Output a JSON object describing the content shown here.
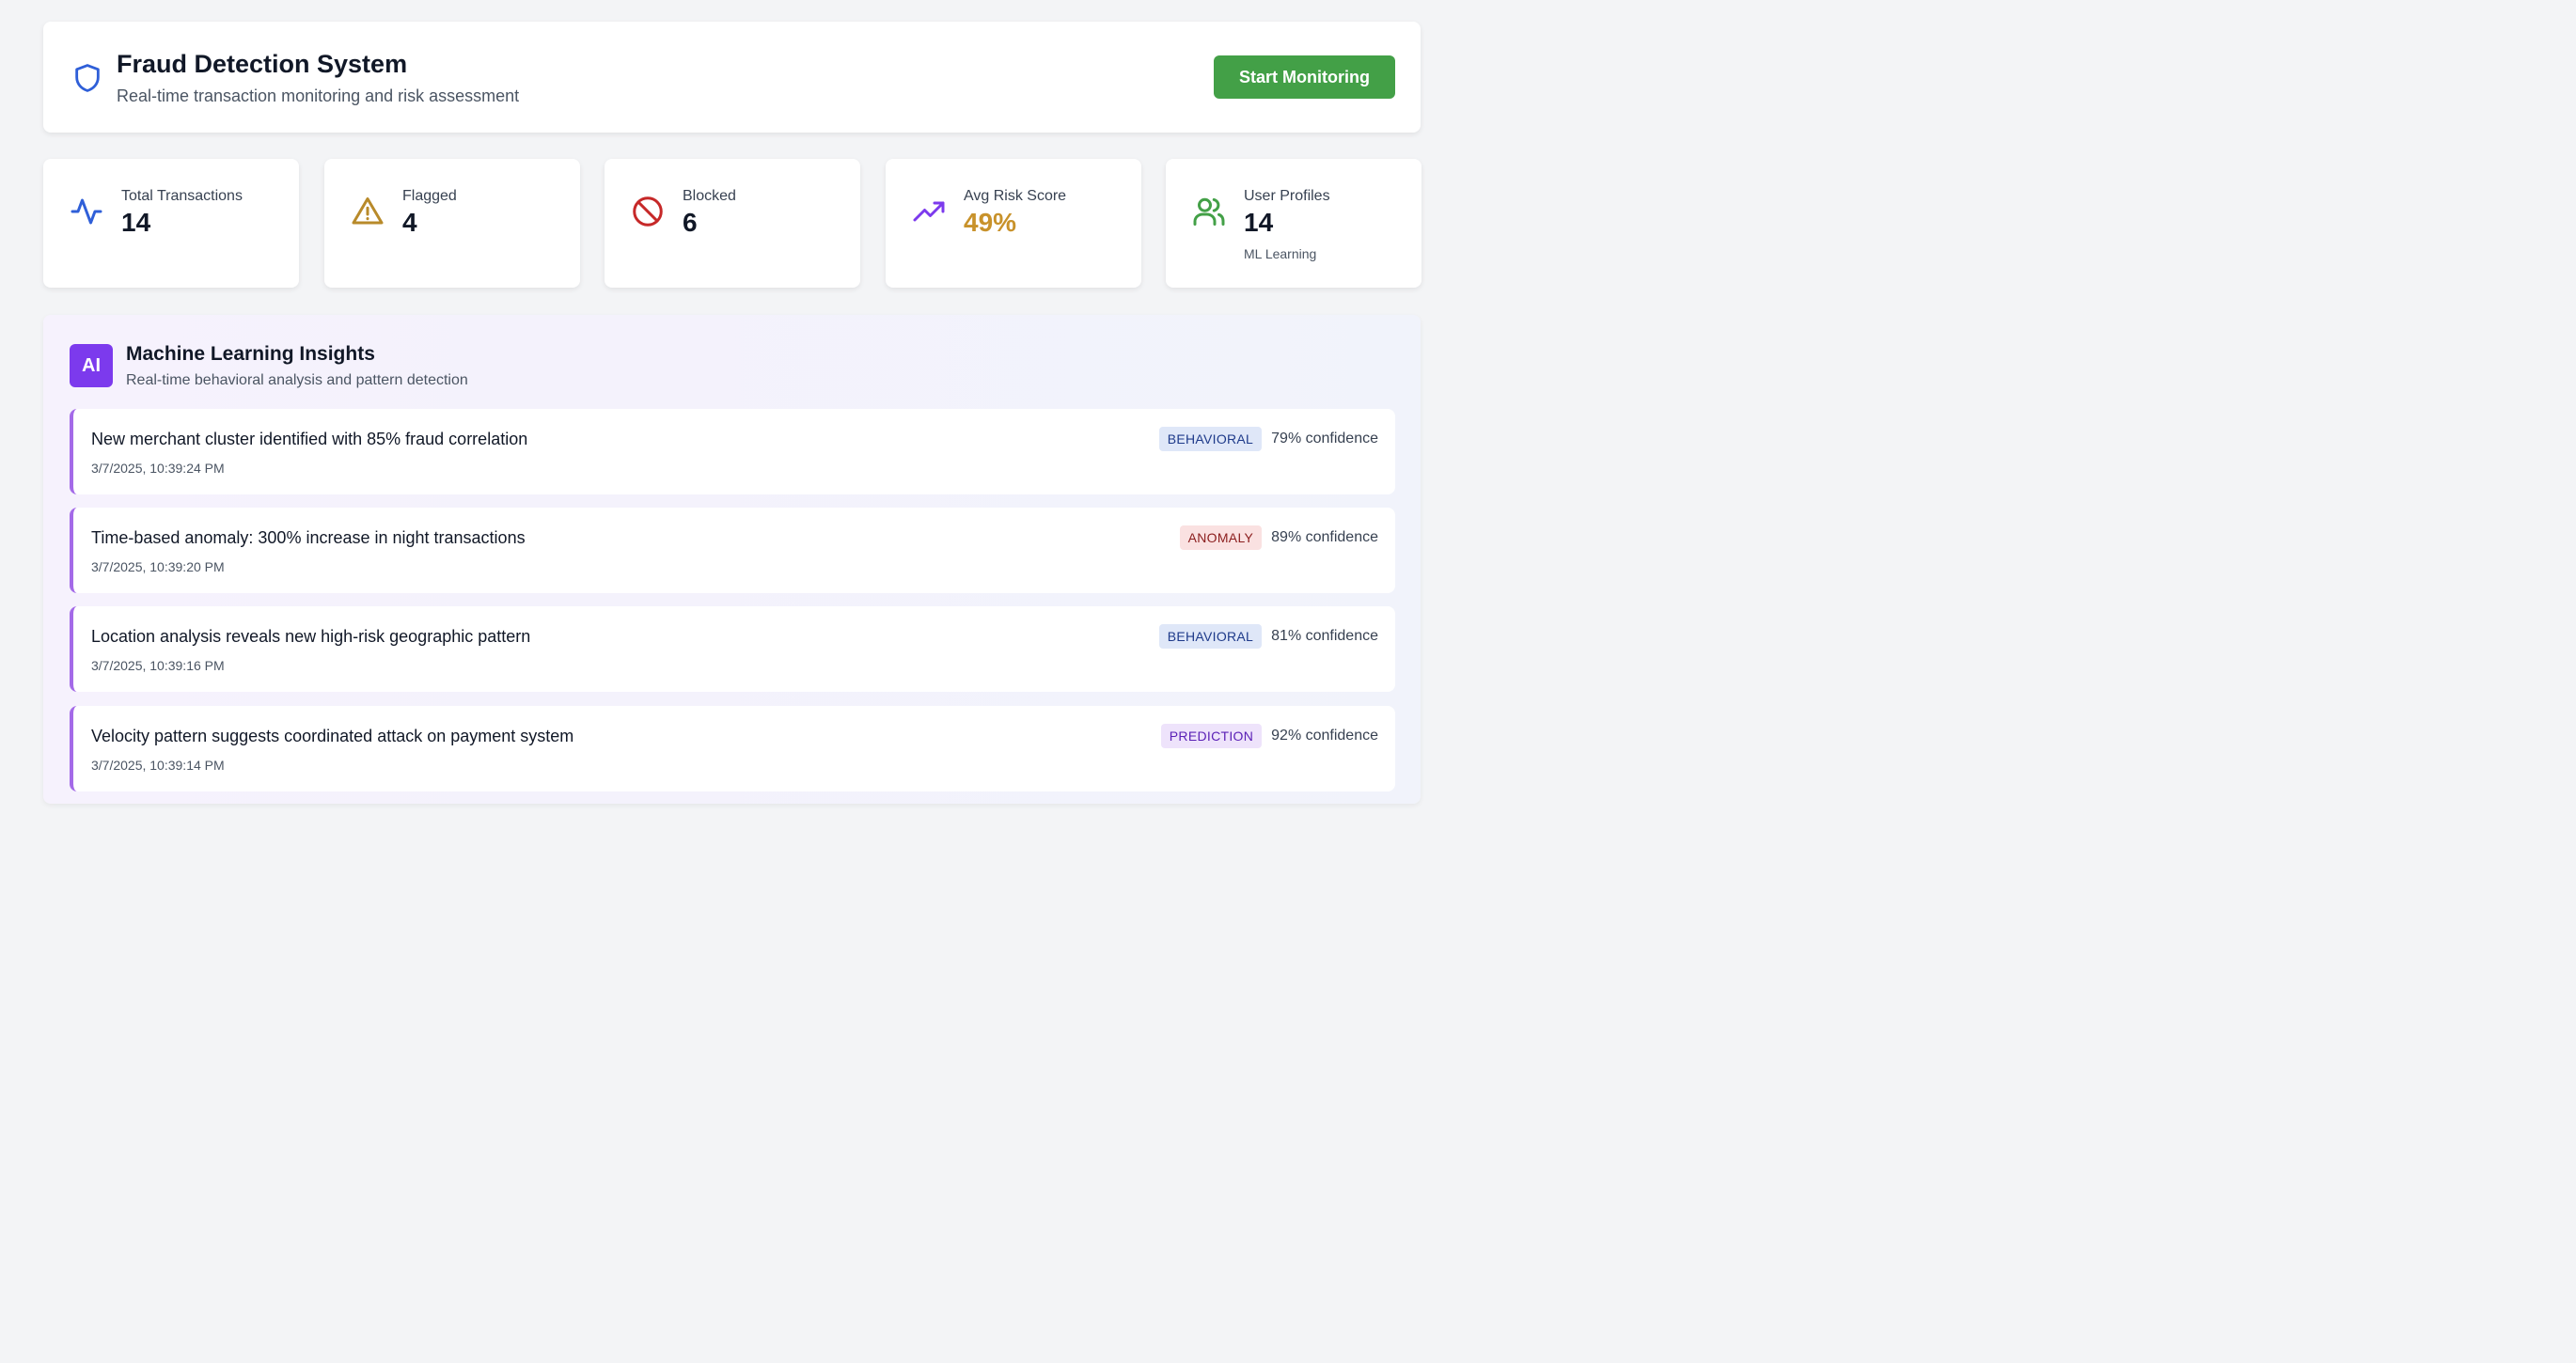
{
  "header": {
    "title": "Fraud Detection System",
    "subtitle": "Real-time transaction monitoring and risk assessment",
    "start_button": "Start Monitoring",
    "icon": "shield-icon"
  },
  "stats": [
    {
      "label": "Total Transactions",
      "value": "14",
      "icon": "activity-icon",
      "color": "#2f5fd8"
    },
    {
      "label": "Flagged",
      "value": "4",
      "icon": "warning-triangle-icon",
      "color": "#b88a2a"
    },
    {
      "label": "Blocked",
      "value": "6",
      "icon": "ban-icon",
      "color": "#c62828"
    },
    {
      "label": "Avg Risk Score",
      "value": "49%",
      "icon": "trending-up-icon",
      "color": "#c8922b"
    },
    {
      "label": "User Profiles",
      "value": "14",
      "note": "ML Learning",
      "icon": "users-icon",
      "color": "#43a047"
    }
  ],
  "ml_insights": {
    "badge": "AI",
    "title": "Machine Learning Insights",
    "subtitle": "Real-time behavioral analysis and pattern detection",
    "items": [
      {
        "text": "New merchant cluster identified with 85% fraud correlation",
        "time": "3/7/2025, 10:39:24 PM",
        "tag": "BEHAVIORAL",
        "confidence": "79% confidence"
      },
      {
        "text": "Time-based anomaly: 300% increase in night transactions",
        "time": "3/7/2025, 10:39:20 PM",
        "tag": "ANOMALY",
        "confidence": "89% confidence"
      },
      {
        "text": "Location analysis reveals new high-risk geographic pattern",
        "time": "3/7/2025, 10:39:16 PM",
        "tag": "BEHAVIORAL",
        "confidence": "81% confidence"
      },
      {
        "text": "Velocity pattern suggests coordinated attack on payment system",
        "time": "3/7/2025, 10:39:14 PM",
        "tag": "PREDICTION",
        "confidence": "92% confidence"
      }
    ]
  },
  "colors": {
    "accent_green": "#43a047",
    "accent_purple": "#7c3aed",
    "risk_score": "#c8922b"
  }
}
